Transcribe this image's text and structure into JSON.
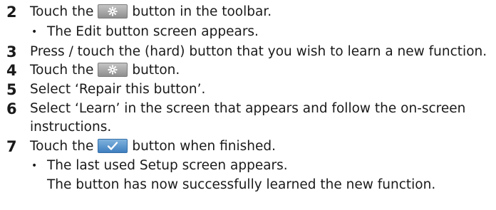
{
  "steps": [
    {
      "number": "2",
      "before": "Touch the",
      "icon": "gear-icon",
      "after": "button in the toolbar."
    },
    {
      "bullet": "•",
      "text": "The Edit button screen appears."
    },
    {
      "number": "3",
      "text": "Press / touch the (hard) button that you wish to learn a new function."
    },
    {
      "number": "4",
      "before": "Touch the",
      "icon": "gear-icon",
      "after": "button."
    },
    {
      "number": "5",
      "text": "Select ‘Repair this button’."
    },
    {
      "number": "6",
      "text": "Select ‘Learn’ in the screen that appears and follow the on-screen",
      "text2": "instructions."
    },
    {
      "number": "7",
      "before": "Touch the",
      "icon": "check-icon",
      "after": "button when finished."
    },
    {
      "bullet": "•",
      "text": "The last used Setup screen appears.",
      "text2": "The button has now successfully learned the new function."
    }
  ],
  "colors": {
    "gear_button": "#a8a8a8",
    "check_button": "#4f8fcf",
    "text": "#1a1a1a"
  }
}
